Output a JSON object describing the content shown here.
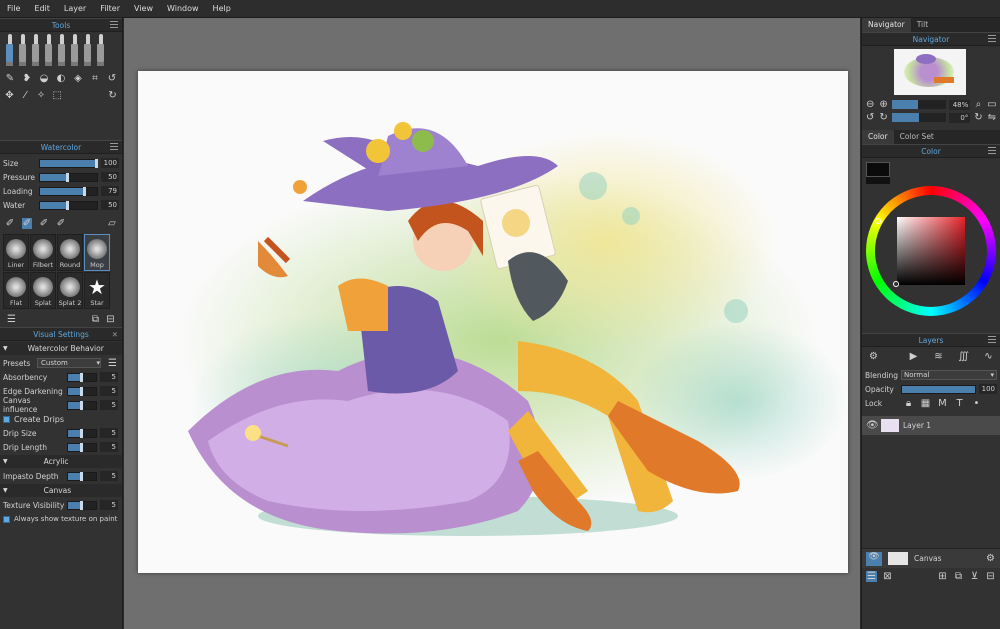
{
  "menu": [
    "File",
    "Edit",
    "Layer",
    "Filter",
    "View",
    "Window",
    "Help"
  ],
  "tools": {
    "title": "Tools"
  },
  "watercolor": {
    "title": "Watercolor",
    "props": [
      {
        "label": "Size",
        "value": "100",
        "level": 1.0
      },
      {
        "label": "Pressure",
        "value": "50",
        "level": 0.5
      },
      {
        "label": "Loading",
        "value": "79",
        "level": 0.79
      },
      {
        "label": "Water",
        "value": "50",
        "level": 0.5
      }
    ],
    "brushes": [
      "Liner",
      "Filbert",
      "Round",
      "Mop",
      "Flat",
      "Splat",
      "Splat 2",
      "Star"
    ]
  },
  "visual": {
    "title": "Visual Settings",
    "behavior": "Watercolor Behavior",
    "presets_label": "Presets",
    "preset_value": "Custom",
    "rows": [
      {
        "label": "Absorbency",
        "value": "5",
        "level": 0.5
      },
      {
        "label": "Edge Darkening",
        "value": "5",
        "level": 0.5
      },
      {
        "label": "Canvas influence",
        "value": "5",
        "level": 0.5
      }
    ],
    "create_drips": "Create Drips",
    "drip_rows": [
      {
        "label": "Drip Size",
        "value": "5",
        "level": 0.5
      },
      {
        "label": "Drip Length",
        "value": "5",
        "level": 0.5
      }
    ],
    "acrylic": "Acrylic",
    "impasto": {
      "label": "Impasto Depth",
      "value": "5",
      "level": 0.5
    },
    "canvas": "Canvas",
    "texture": {
      "label": "Texture Visibility",
      "value": "5",
      "level": 0.5
    },
    "always_show": "Always show texture on paint"
  },
  "right": {
    "tabs": [
      "Navigator",
      "Tilt"
    ],
    "navigator_title": "Navigator",
    "zoom": "48%",
    "rotation": "0°",
    "color_tabs": [
      "Color",
      "Color Set"
    ],
    "color_title": "Color",
    "layers_title": "Layers",
    "blending_label": "Blending",
    "blending_value": "Normal",
    "opacity_label": "Opacity",
    "opacity_value": "100",
    "lock_label": "Lock",
    "layer_name": "Layer 1",
    "canvas_label": "Canvas"
  }
}
